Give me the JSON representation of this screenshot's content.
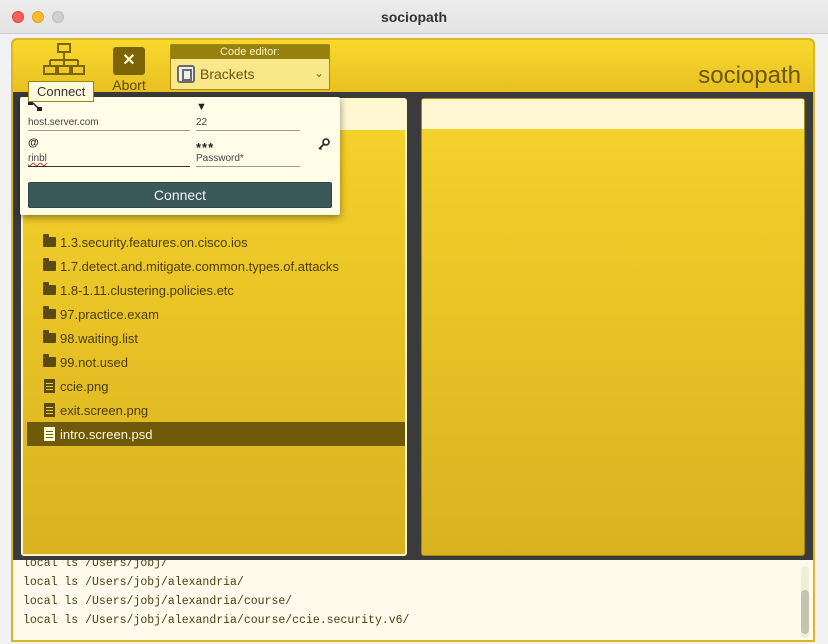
{
  "window": {
    "title": "sociopath"
  },
  "toolbar": {
    "connect_label": "Connect",
    "abort_label": "Abort",
    "abort_glyph": "✕",
    "editor_label": "Code editor:",
    "editor_value": "Brackets",
    "app_title": "sociopath"
  },
  "tooltip": "Connect",
  "connect_dialog": {
    "host_value": "host.server.com",
    "port_value": "22",
    "user_value": "rinbl",
    "password_mask": "***",
    "password_placeholder": "Password*",
    "button_label": "Connect"
  },
  "file_list": [
    {
      "type": "folder",
      "name": "1.3.security.features.on.cisco.ios"
    },
    {
      "type": "folder",
      "name": "1.7.detect.and.mitigate.common.types.of.attacks"
    },
    {
      "type": "folder",
      "name": "1.8-1.11.clustering.policies.etc"
    },
    {
      "type": "folder",
      "name": "97.practice.exam"
    },
    {
      "type": "folder",
      "name": "98.waiting.list"
    },
    {
      "type": "folder",
      "name": "99.not.used"
    },
    {
      "type": "file",
      "name": "ccie.png"
    },
    {
      "type": "file",
      "name": "exit.screen.png"
    },
    {
      "type": "file",
      "name": "intro.screen.psd",
      "selected": true
    }
  ],
  "console": [
    "local ls /Users/jobj/",
    "local ls /Users/jobj/alexandria/",
    "local ls /Users/jobj/alexandria/course/",
    "local ls /Users/jobj/alexandria/course/ccie.security.v6/"
  ],
  "colors": {
    "accent": "#f6d32c",
    "selected_row": "#6f5a09",
    "button": "#3a5958"
  }
}
